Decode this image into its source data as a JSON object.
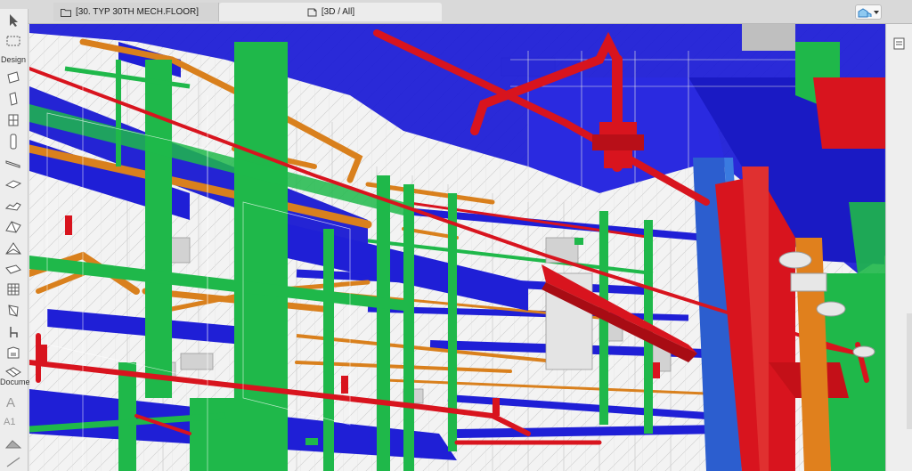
{
  "tabs": {
    "floor_plan": "[30. TYP 30TH MECH.FLOOR]",
    "view3d": "[3D / All]"
  },
  "toolbox": {
    "design_label": "Design",
    "document_label": "Docume",
    "text_tool": "A",
    "label_tool": "A1"
  },
  "colors": {
    "duct_blue": "#1f1fd6",
    "pipe_green": "#1fb84a",
    "pipe_red": "#d8141e",
    "pipe_orange": "#d9801d"
  }
}
